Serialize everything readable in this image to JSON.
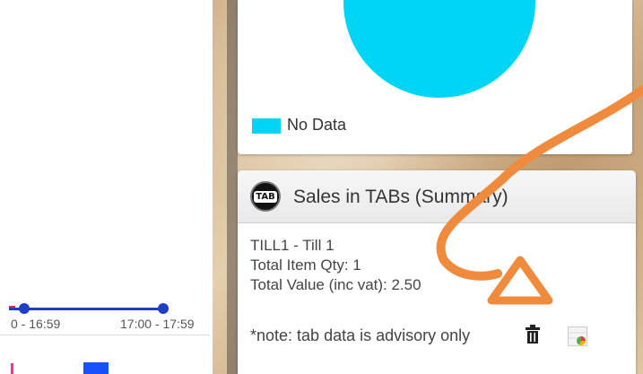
{
  "timeline": {
    "label_left": "0 - 16:59",
    "label_right": "17:00 - 17:59"
  },
  "top_card": {
    "legend_label": "No Data",
    "pie_color": "#00d5f5"
  },
  "tab_card": {
    "logo_text": "TAB",
    "title": "Sales in TABs (Summary)",
    "till": "TILL1 - Till 1",
    "total_item_qty": "Total Item Qty: 1",
    "total_value": "Total Value (inc vat): 2.50",
    "note": "*note: tab data is advisory only",
    "icons": [
      "trash-icon",
      "pie-chart-icon"
    ]
  },
  "annotation_color": "#f08a3c"
}
